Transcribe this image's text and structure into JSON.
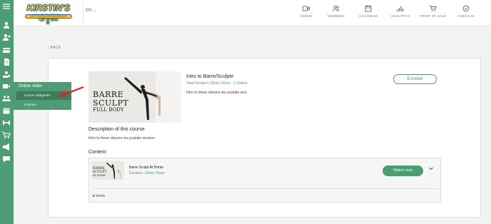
{
  "header": {
    "logo_title": "KIRSTIN'S GYM",
    "logo_subtitle": "LIFE EXERCISE WORKOUT STUDIO",
    "language": "EN",
    "nav": [
      {
        "label": "VIDEOS",
        "icon": "video-icon"
      },
      {
        "label": "MEMBERS",
        "icon": "members-icon"
      },
      {
        "label": "CALENDAR",
        "icon": "calendar-icon"
      },
      {
        "label": "ANALYTICS",
        "icon": "analytics-icon"
      },
      {
        "label": "POINT OF SALE",
        "icon": "cart-icon"
      },
      {
        "label": "CHECK-IN",
        "icon": "check-in-icon"
      }
    ]
  },
  "sidebar": {
    "icons": [
      "menu-icon",
      "user-icon",
      "user-add-icon",
      "card-icon",
      "document-icon",
      "hand-icon",
      "video-icon",
      "group-icon",
      "calendar-icon",
      "dumbbell-icon",
      "cart-icon",
      "megaphone-icon",
      "chat-icon"
    ],
    "flyout": {
      "title": "Online video",
      "items": [
        {
          "label": "Course categories"
        },
        {
          "label": "Courses"
        }
      ]
    }
  },
  "main": {
    "back_label": "BACK",
    "course": {
      "image_text_line1": "BARRE",
      "image_text_line2": "SCULPT",
      "image_text_line3": "FULL BODY",
      "title": "Intro to Barre/Sculpte",
      "duration": "Total Duration: 29min 39sec - 1 Videos",
      "description": "Intro to these classes via youtube woo",
      "status": "Enrolled"
    },
    "description_heading": "Description of this course",
    "description_text": "Intro to these classes via youtube woohoo",
    "content_heading": "Content",
    "videos": [
      {
        "thumb_line1": "BARRE",
        "thumb_line2": "SCULPT",
        "thumb_line3": "AT HOME",
        "title": "Barre Sculpt At Home",
        "duration": "Duration: 29min 39sec",
        "watch_label": "Watch now",
        "note": "at home"
      }
    ]
  },
  "colors": {
    "brand_green": "#4e9c74",
    "dark_green": "#3d7e5d",
    "logo_yellow": "#f6c722",
    "logo_blue": "#2b5a9a",
    "annotation_red": "#e02020"
  }
}
